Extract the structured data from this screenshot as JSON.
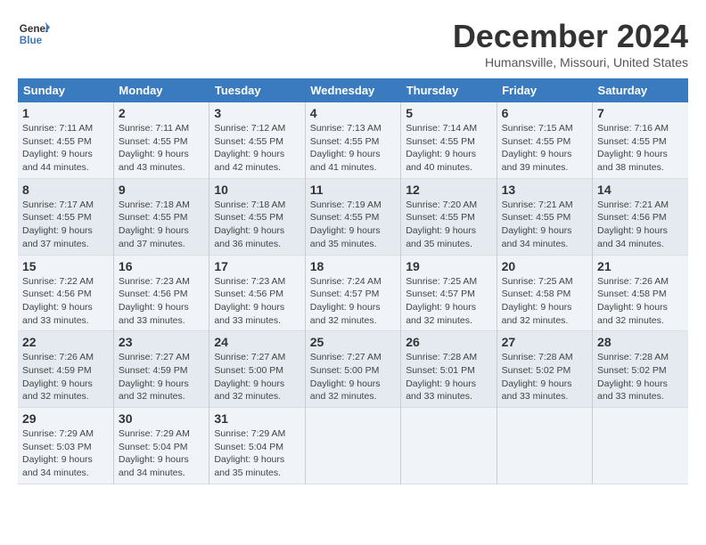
{
  "header": {
    "logo_line1": "General",
    "logo_line2": "Blue",
    "month": "December 2024",
    "location": "Humansville, Missouri, United States"
  },
  "weekdays": [
    "Sunday",
    "Monday",
    "Tuesday",
    "Wednesday",
    "Thursday",
    "Friday",
    "Saturday"
  ],
  "weeks": [
    [
      {
        "day": "1",
        "info": "Sunrise: 7:11 AM\nSunset: 4:55 PM\nDaylight: 9 hours\nand 44 minutes."
      },
      {
        "day": "2",
        "info": "Sunrise: 7:11 AM\nSunset: 4:55 PM\nDaylight: 9 hours\nand 43 minutes."
      },
      {
        "day": "3",
        "info": "Sunrise: 7:12 AM\nSunset: 4:55 PM\nDaylight: 9 hours\nand 42 minutes."
      },
      {
        "day": "4",
        "info": "Sunrise: 7:13 AM\nSunset: 4:55 PM\nDaylight: 9 hours\nand 41 minutes."
      },
      {
        "day": "5",
        "info": "Sunrise: 7:14 AM\nSunset: 4:55 PM\nDaylight: 9 hours\nand 40 minutes."
      },
      {
        "day": "6",
        "info": "Sunrise: 7:15 AM\nSunset: 4:55 PM\nDaylight: 9 hours\nand 39 minutes."
      },
      {
        "day": "7",
        "info": "Sunrise: 7:16 AM\nSunset: 4:55 PM\nDaylight: 9 hours\nand 38 minutes."
      }
    ],
    [
      {
        "day": "8",
        "info": "Sunrise: 7:17 AM\nSunset: 4:55 PM\nDaylight: 9 hours\nand 37 minutes."
      },
      {
        "day": "9",
        "info": "Sunrise: 7:18 AM\nSunset: 4:55 PM\nDaylight: 9 hours\nand 37 minutes."
      },
      {
        "day": "10",
        "info": "Sunrise: 7:18 AM\nSunset: 4:55 PM\nDaylight: 9 hours\nand 36 minutes."
      },
      {
        "day": "11",
        "info": "Sunrise: 7:19 AM\nSunset: 4:55 PM\nDaylight: 9 hours\nand 35 minutes."
      },
      {
        "day": "12",
        "info": "Sunrise: 7:20 AM\nSunset: 4:55 PM\nDaylight: 9 hours\nand 35 minutes."
      },
      {
        "day": "13",
        "info": "Sunrise: 7:21 AM\nSunset: 4:55 PM\nDaylight: 9 hours\nand 34 minutes."
      },
      {
        "day": "14",
        "info": "Sunrise: 7:21 AM\nSunset: 4:56 PM\nDaylight: 9 hours\nand 34 minutes."
      }
    ],
    [
      {
        "day": "15",
        "info": "Sunrise: 7:22 AM\nSunset: 4:56 PM\nDaylight: 9 hours\nand 33 minutes."
      },
      {
        "day": "16",
        "info": "Sunrise: 7:23 AM\nSunset: 4:56 PM\nDaylight: 9 hours\nand 33 minutes."
      },
      {
        "day": "17",
        "info": "Sunrise: 7:23 AM\nSunset: 4:56 PM\nDaylight: 9 hours\nand 33 minutes."
      },
      {
        "day": "18",
        "info": "Sunrise: 7:24 AM\nSunset: 4:57 PM\nDaylight: 9 hours\nand 32 minutes."
      },
      {
        "day": "19",
        "info": "Sunrise: 7:25 AM\nSunset: 4:57 PM\nDaylight: 9 hours\nand 32 minutes."
      },
      {
        "day": "20",
        "info": "Sunrise: 7:25 AM\nSunset: 4:58 PM\nDaylight: 9 hours\nand 32 minutes."
      },
      {
        "day": "21",
        "info": "Sunrise: 7:26 AM\nSunset: 4:58 PM\nDaylight: 9 hours\nand 32 minutes."
      }
    ],
    [
      {
        "day": "22",
        "info": "Sunrise: 7:26 AM\nSunset: 4:59 PM\nDaylight: 9 hours\nand 32 minutes."
      },
      {
        "day": "23",
        "info": "Sunrise: 7:27 AM\nSunset: 4:59 PM\nDaylight: 9 hours\nand 32 minutes."
      },
      {
        "day": "24",
        "info": "Sunrise: 7:27 AM\nSunset: 5:00 PM\nDaylight: 9 hours\nand 32 minutes."
      },
      {
        "day": "25",
        "info": "Sunrise: 7:27 AM\nSunset: 5:00 PM\nDaylight: 9 hours\nand 32 minutes."
      },
      {
        "day": "26",
        "info": "Sunrise: 7:28 AM\nSunset: 5:01 PM\nDaylight: 9 hours\nand 33 minutes."
      },
      {
        "day": "27",
        "info": "Sunrise: 7:28 AM\nSunset: 5:02 PM\nDaylight: 9 hours\nand 33 minutes."
      },
      {
        "day": "28",
        "info": "Sunrise: 7:28 AM\nSunset: 5:02 PM\nDaylight: 9 hours\nand 33 minutes."
      }
    ],
    [
      {
        "day": "29",
        "info": "Sunrise: 7:29 AM\nSunset: 5:03 PM\nDaylight: 9 hours\nand 34 minutes."
      },
      {
        "day": "30",
        "info": "Sunrise: 7:29 AM\nSunset: 5:04 PM\nDaylight: 9 hours\nand 34 minutes."
      },
      {
        "day": "31",
        "info": "Sunrise: 7:29 AM\nSunset: 5:04 PM\nDaylight: 9 hours\nand 35 minutes."
      },
      {
        "day": "",
        "info": ""
      },
      {
        "day": "",
        "info": ""
      },
      {
        "day": "",
        "info": ""
      },
      {
        "day": "",
        "info": ""
      }
    ]
  ]
}
